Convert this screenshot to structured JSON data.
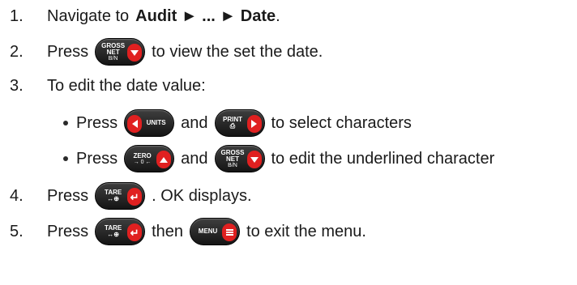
{
  "steps": [
    {
      "num": "1.",
      "text_a": "Navigate to ",
      "bold_a": "Audit ► ... ► Date",
      "text_b": "."
    },
    {
      "num": "2.",
      "text_a": "Press",
      "text_b": "to view the set the date."
    },
    {
      "num": "3.",
      "text_a": "To edit the date value:"
    },
    {
      "num": "4.",
      "text_a": "Press",
      "text_b": ". OK displays."
    },
    {
      "num": "5.",
      "text_a": "Press",
      "text_b": "then",
      "text_c": "to exit the menu."
    }
  ],
  "sub_steps": [
    {
      "text_a": "Press",
      "text_b": "and",
      "text_c": "to select characters"
    },
    {
      "text_a": "Press",
      "text_b": "and",
      "text_c": "to edit the underlined character"
    }
  ],
  "keys": {
    "gross": {
      "line1": "GROSS",
      "line2": "NET",
      "line3": "B/N",
      "icon": "down-arrow-icon"
    },
    "units": {
      "line1": "UNITS",
      "icon": "left-arrow-icon"
    },
    "print": {
      "line1": "PRINT",
      "line2": "⎙",
      "icon": "right-arrow-icon"
    },
    "zero": {
      "line1": "ZERO",
      "line2": "→ 0 ←",
      "icon": "up-arrow-icon"
    },
    "tare": {
      "line1": "TARE",
      "line2": "↔⊕",
      "icon": "enter-icon"
    },
    "menu": {
      "line1": "MENU",
      "icon": "menu-icon"
    }
  },
  "colors": {
    "key_body": "#1f1f1f",
    "key_accent": "#e02020",
    "text": "#1a1a1a"
  }
}
